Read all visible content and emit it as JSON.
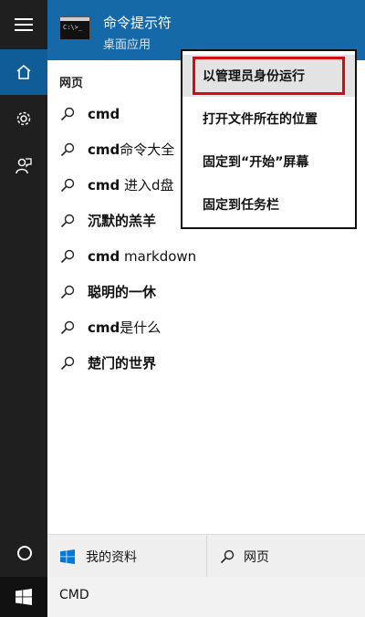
{
  "top_result": {
    "title": "命令提示符",
    "subtitle": "桌面应用",
    "tile_text": "C:\\>_"
  },
  "web_section": {
    "title": "网页"
  },
  "results": [
    {
      "bold": "cmd",
      "rest": ""
    },
    {
      "bold": "cmd",
      "rest": "命令大全"
    },
    {
      "bold": "cmd",
      "rest": " 进入d盘"
    },
    {
      "bold": "",
      "rest": "沉默的羔羊"
    },
    {
      "bold": "cmd",
      "rest": " markdown"
    },
    {
      "bold": "",
      "rest": "聪明的一休"
    },
    {
      "bold": "cmd",
      "rest": "是什么"
    },
    {
      "bold": "",
      "rest": "楚门的世界"
    }
  ],
  "context_menu": {
    "items": [
      "以管理员身份运行",
      "打开文件所在的位置",
      "固定到“开始”屏幕",
      "固定到任务栏"
    ],
    "highlighted_index": 0
  },
  "filter_bar": {
    "my_stuff": "我的资料",
    "web": "网页"
  },
  "search": {
    "value": "CMD"
  },
  "icons": {
    "menu": "hamburger-icon",
    "home": "home-icon",
    "settings": "gear-icon",
    "feedback": "feedback-icon",
    "cortana": "cortana-ring-icon",
    "windows": "windows-logo-icon",
    "search": "search-icon"
  },
  "colors": {
    "rail": "#1f1f1f",
    "rail_active": "#0f5c96",
    "top_result": "#1569a8",
    "highlight_box": "#d40b16",
    "windows_blue": "#0078d7"
  }
}
